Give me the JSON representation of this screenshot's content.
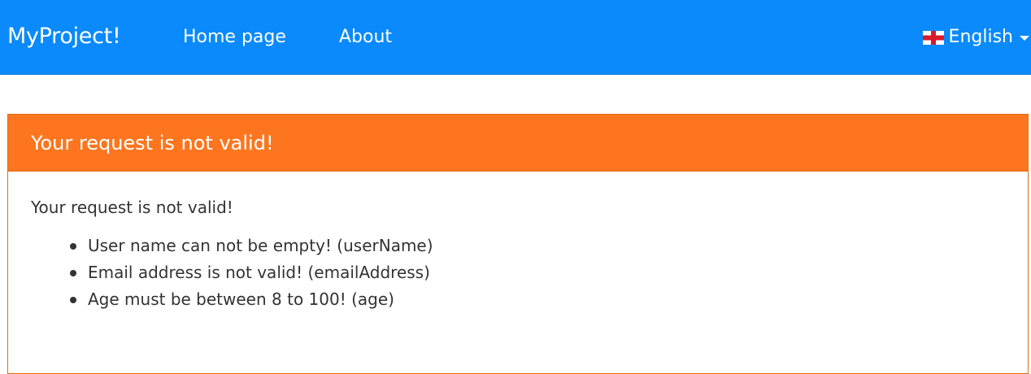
{
  "navbar": {
    "brand": "MyProject!",
    "links": [
      {
        "label": "Home page"
      },
      {
        "label": "About"
      }
    ],
    "language": {
      "label": "English",
      "flag_icon": "england-flag-icon"
    },
    "colors": {
      "background": "#0a8afc",
      "text": "#ffffff"
    }
  },
  "error_panel": {
    "heading": "Your request is not valid!",
    "message": "Your request is not valid!",
    "errors": [
      "User name can not be empty! (userName)",
      "Email address is not valid! (emailAddress)",
      "Age must be between 8 to 100! (age)"
    ],
    "colors": {
      "heading_background": "#fd761f",
      "border": "#e46d12"
    }
  }
}
